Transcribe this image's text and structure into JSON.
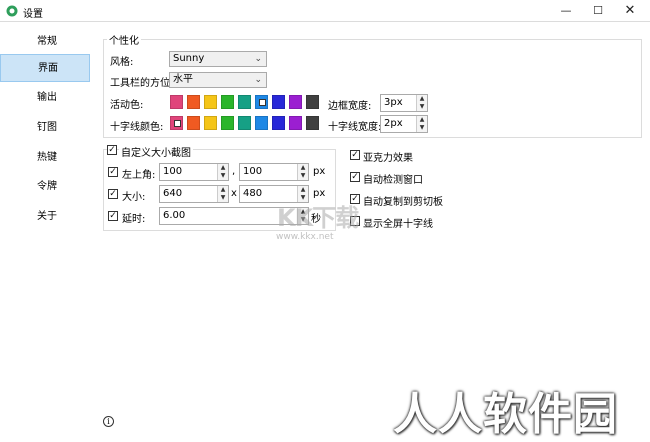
{
  "window": {
    "title": "设置"
  },
  "sidebar": {
    "items": [
      {
        "label": "常规"
      },
      {
        "label": "界面"
      },
      {
        "label": "输出"
      },
      {
        "label": "钉图"
      },
      {
        "label": "热键"
      },
      {
        "label": "令牌"
      },
      {
        "label": "关于"
      }
    ],
    "active_index": 1
  },
  "personalize": {
    "group_title": "个性化",
    "style_label": "风格:",
    "style_value": "Sunny",
    "toolbar_pos_label": "工具栏的方位:",
    "toolbar_pos_value": "水平",
    "active_color_label": "活动色:",
    "crosshair_color_label": "十字线颜色:",
    "border_width_label": "边框宽度:",
    "border_width_value": "3px",
    "crosshair_width_label": "十字线宽度:",
    "crosshair_width_value": "2px",
    "palette": [
      "#e0457b",
      "#f05a22",
      "#f5c518",
      "#2bb52b",
      "#16a085",
      "#1e88e5",
      "#2828d8",
      "#9b1fd1",
      "#404040"
    ],
    "active_selected_index": 5,
    "crosshair_selected_index": 0
  },
  "custom": {
    "title": "自定义大小截图",
    "topleft_label": "左上角:",
    "topleft_x": "100",
    "topleft_sep": ",",
    "topleft_y": "100",
    "topleft_unit": "px",
    "size_label": "大小:",
    "size_w": "640",
    "size_sep": "x",
    "size_h": "480",
    "size_unit": "px",
    "delay_label": "延时:",
    "delay_value": "6.00",
    "delay_unit": "秒"
  },
  "options": [
    {
      "label": "亚克力效果",
      "checked": true
    },
    {
      "label": "自动检测窗口",
      "checked": true
    },
    {
      "label": "自动复制到剪切板",
      "checked": true
    },
    {
      "label": "显示全屏十字线",
      "checked": false
    }
  ],
  "watermark": {
    "line1": "KK下载",
    "line2": "www.kkx.net",
    "line3": "人人软件园"
  }
}
